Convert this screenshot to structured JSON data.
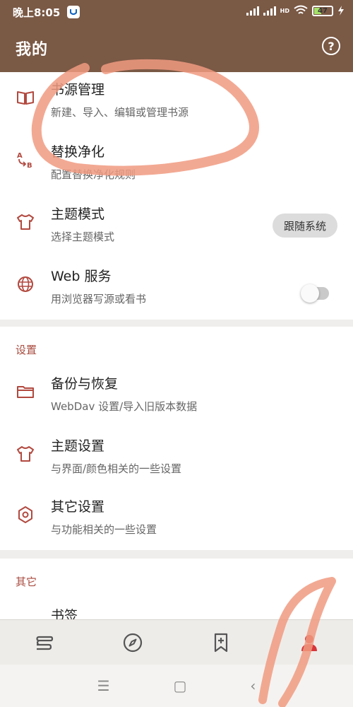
{
  "status_bar": {
    "time": "晚上8:05",
    "network": "HD",
    "battery": "47"
  },
  "app_bar": {
    "title": "我的",
    "help_icon": "question-circle-icon"
  },
  "main_items": [
    {
      "icon": "book-icon",
      "title": "书源管理",
      "subtitle": "新建、导入、编辑或管理书源"
    },
    {
      "icon": "replace-ab-icon",
      "title": "替换净化",
      "subtitle": "配置替换净化规则"
    },
    {
      "icon": "tshirt-icon",
      "title": "主题模式",
      "subtitle": "选择主题模式",
      "button": "跟随系统"
    },
    {
      "icon": "globe-icon",
      "title": "Web 服务",
      "subtitle": "用浏览器写源或看书",
      "toggle": false
    }
  ],
  "settings_section": {
    "label": "设置",
    "items": [
      {
        "icon": "folder-icon",
        "title": "备份与恢复",
        "subtitle": "WebDav 设置/导入旧版本数据"
      },
      {
        "icon": "tshirt-icon",
        "title": "主题设置",
        "subtitle": "与界面/颜色相关的一些设置"
      },
      {
        "icon": "gear-hexagon-icon",
        "title": "其它设置",
        "subtitle": "与功能相关的一些设置"
      }
    ]
  },
  "other_section": {
    "label": "其它",
    "items": [
      {
        "icon": "bookmark-icon",
        "title": "书签"
      }
    ]
  },
  "bottom_nav": [
    {
      "icon": "bookshelf-icon",
      "active": false
    },
    {
      "icon": "compass-icon",
      "active": false
    },
    {
      "icon": "bookmark-add-icon",
      "active": false
    },
    {
      "icon": "person-icon",
      "active": true
    }
  ],
  "colors": {
    "primary": "#7a5945",
    "accent": "#b2493f",
    "active": "#d6363a",
    "annotation": "#f09a80"
  }
}
